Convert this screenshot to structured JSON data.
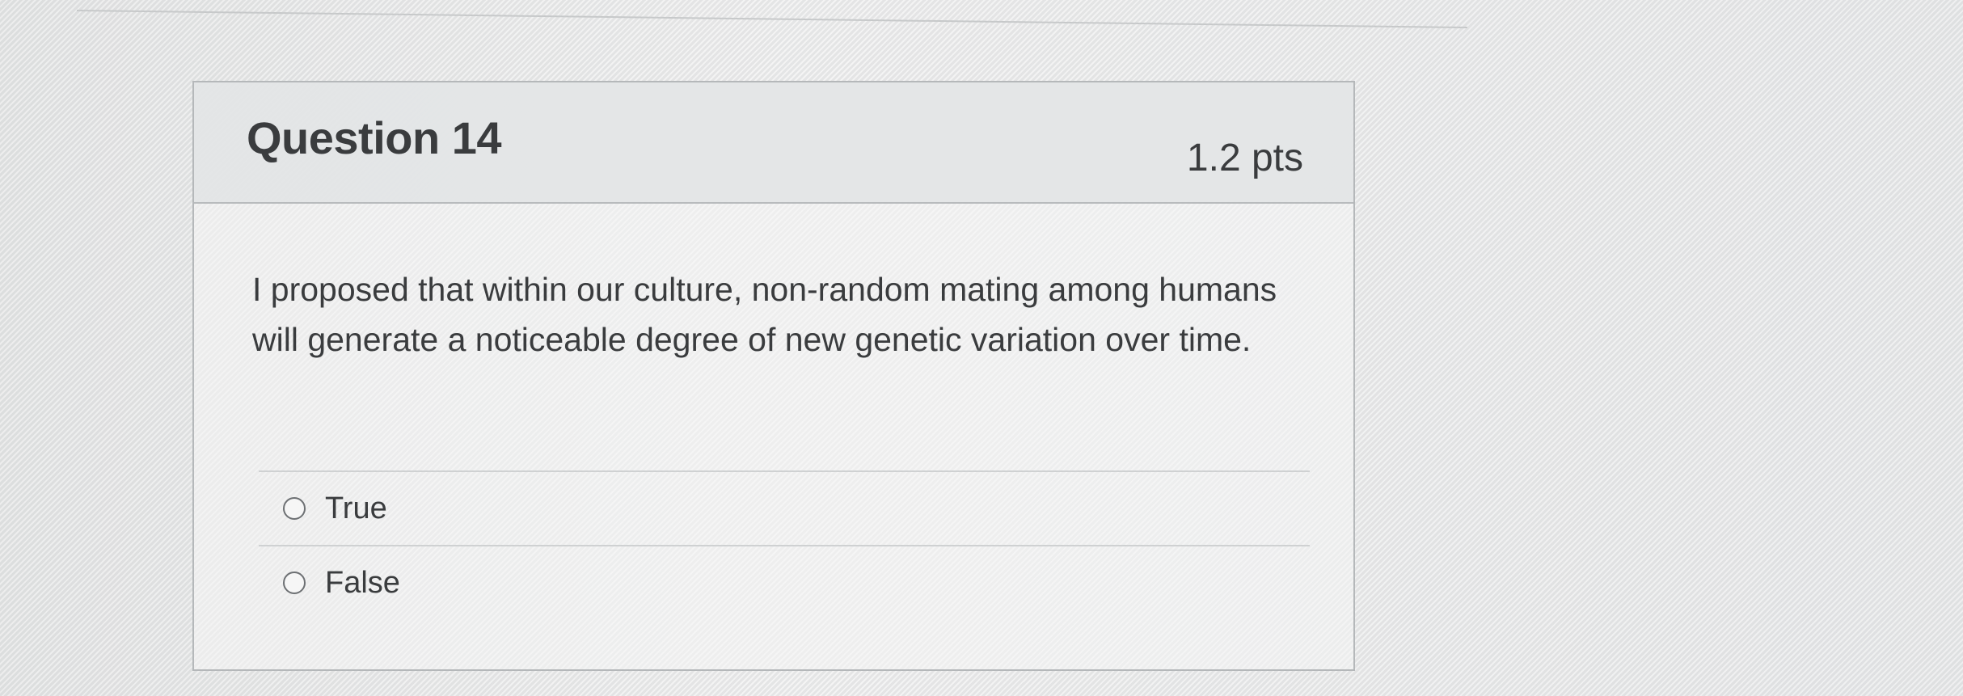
{
  "question": {
    "title": "Question 14",
    "points": "1.2 pts",
    "text": "I proposed that within our culture, non-random mating among humans will generate a noticeable degree of new genetic variation over time."
  },
  "answers": [
    {
      "label": "True",
      "selected": false
    },
    {
      "label": "False",
      "selected": false
    }
  ]
}
